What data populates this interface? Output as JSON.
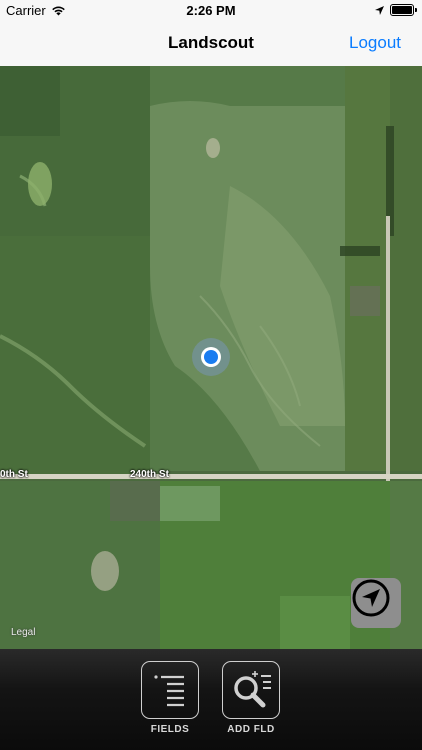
{
  "status_bar": {
    "carrier": "Carrier",
    "time": "2:26 PM"
  },
  "navbar": {
    "title": "Landscout",
    "logout_label": "Logout"
  },
  "map": {
    "road_label_left": "0th St",
    "road_label_center": "240th St",
    "legal_label": "Legal"
  },
  "toolbar": {
    "fields_label": "FIELDS",
    "add_field_label": "ADD FLD"
  },
  "colors": {
    "accent": "#0a7cff",
    "location_dot": "#1a7cf0"
  }
}
